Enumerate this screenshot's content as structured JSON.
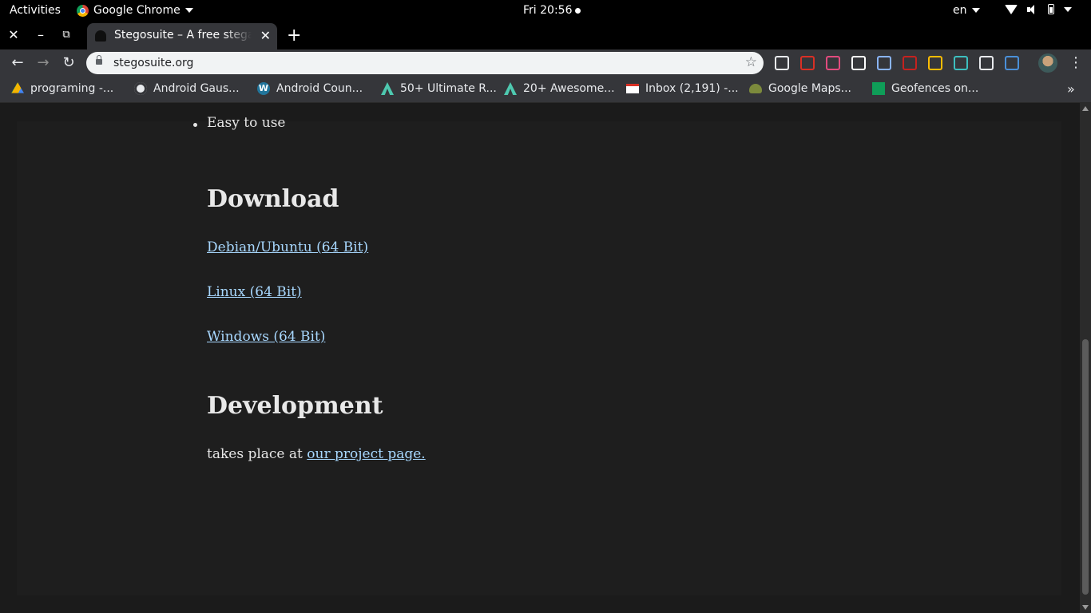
{
  "topbar": {
    "activities": "Activities",
    "app_name": "Google Chrome",
    "clock": "Fri 20:56",
    "lang": "en"
  },
  "tab": {
    "title": "Stegosuite – A free steganography tool"
  },
  "omnibox": {
    "url": "stegosuite.org"
  },
  "extensions": [
    {
      "name": "keyboard-icon",
      "color": "#e8eaed"
    },
    {
      "name": "off-badge-icon",
      "color": "#d93025"
    },
    {
      "name": "feather-icon",
      "color": "#e24b7e"
    },
    {
      "name": "circle-extension-icon",
      "color": "#ffffff"
    },
    {
      "name": "download-icon",
      "color": "#8ab4f8"
    },
    {
      "name": "book-icon",
      "color": "#c5221f"
    },
    {
      "name": "palette-icon",
      "color": "#fbbc04"
    },
    {
      "name": "network-icon",
      "color": "#3dbfbf"
    },
    {
      "name": "pen-icon",
      "color": "#e8eaed"
    },
    {
      "name": "image-extension-icon",
      "color": "#4a90d9"
    }
  ],
  "bookmarks": [
    {
      "label": "programing -...",
      "icon": "drive-icon"
    },
    {
      "label": "Android Gaus...",
      "icon": "globe-icon"
    },
    {
      "label": "Android Coun...",
      "icon": "wordpress-icon"
    },
    {
      "label": "50+ Ultimate R...",
      "icon": "android-arsenal-icon"
    },
    {
      "label": "20+ Awesome...",
      "icon": "android-arsenal-icon"
    },
    {
      "label": "Inbox (2,191) -...",
      "icon": "gmail-icon"
    },
    {
      "label": "Google Maps...",
      "icon": "android-icon"
    },
    {
      "label": "Geofences on...",
      "icon": "chart-icon"
    }
  ],
  "page": {
    "bullet": "Easy to use",
    "download_heading": "Download",
    "downloads": [
      "Debian/Ubuntu (64 Bit)",
      "Linux (64 Bit)",
      "Windows (64 Bit)"
    ],
    "development_heading": "Development",
    "development_text": "takes place at ",
    "development_link": "our project page."
  }
}
